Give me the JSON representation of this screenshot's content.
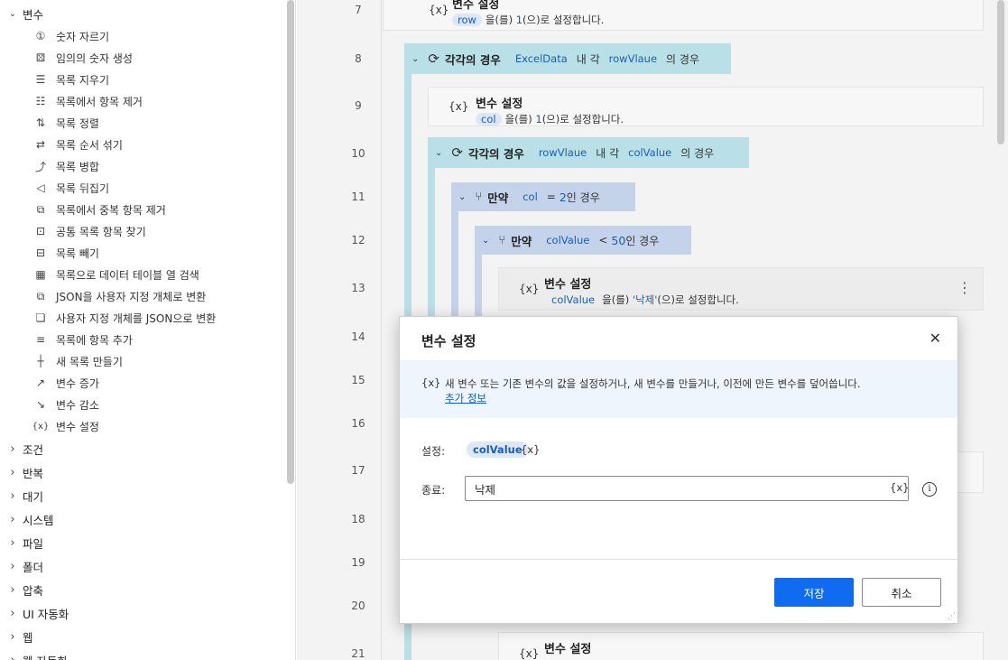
{
  "sidebar": {
    "open_category": "변수",
    "actions": [
      {
        "icon": "number-trim-icon",
        "label": "숫자 자르기"
      },
      {
        "icon": "random-number-icon",
        "label": "임의의 숫자 생성"
      },
      {
        "icon": "clear-list-icon",
        "label": "목록 지우기"
      },
      {
        "icon": "remove-item-icon",
        "label": "목록에서 항목 제거"
      },
      {
        "icon": "sort-list-icon",
        "label": "목록 정렬"
      },
      {
        "icon": "shuffle-list-icon",
        "label": "목록 순서 섞기"
      },
      {
        "icon": "merge-list-icon",
        "label": "목록 병합"
      },
      {
        "icon": "reverse-list-icon",
        "label": "목록 뒤집기"
      },
      {
        "icon": "remove-duplicates-icon",
        "label": "목록에서 중복 항목 제거"
      },
      {
        "icon": "common-items-icon",
        "label": "공통 목록 항목 찾기"
      },
      {
        "icon": "subtract-list-icon",
        "label": "목록 빼기"
      },
      {
        "icon": "list-to-datatable-icon",
        "label": "목록으로 데이터 테이블 열 검색"
      },
      {
        "icon": "json-to-object-icon",
        "label": "JSON을 사용자 지정 개체로 변환"
      },
      {
        "icon": "object-to-json-icon",
        "label": "사용자 지정 개체를 JSON으로 변환"
      },
      {
        "icon": "add-item-icon",
        "label": "목록에 항목 추가"
      },
      {
        "icon": "new-list-icon",
        "label": "새 목록 만들기"
      },
      {
        "icon": "increase-icon",
        "label": "변수 증가"
      },
      {
        "icon": "decrease-icon",
        "label": "변수 감소"
      },
      {
        "icon": "variable-icon",
        "label": "변수 설정"
      }
    ],
    "categories": [
      "조건",
      "반복",
      "대기",
      "시스템",
      "파일",
      "폴더",
      "압축",
      "UI 자동화",
      "웹",
      "웹 자동화"
    ]
  },
  "flow": {
    "line_numbers": [
      "7",
      "8",
      "9",
      "10",
      "11",
      "12",
      "13",
      "14",
      "15",
      "16",
      "17",
      "18",
      "19",
      "20",
      "21"
    ],
    "step7": {
      "title": "변수 설정",
      "var": "row",
      "mid": "을(를)",
      "value": "1",
      "suffix": "(으)로 설정합니다."
    },
    "loop8": {
      "keyword": "각각의 경우",
      "list": "ExcelData",
      "mid": "내 각",
      "item": "rowVlaue",
      "suffix": "의 경우"
    },
    "step9": {
      "title": "변수 설정",
      "var": "col",
      "mid": "을(를)",
      "value": "1",
      "suffix": "(으)로 설정합니다."
    },
    "loop10": {
      "keyword": "각각의 경우",
      "list": "rowVlaue",
      "mid": "내 각",
      "item": "colValue",
      "suffix": "의 경우"
    },
    "if11": {
      "keyword": "만약",
      "var": "col",
      "op": "=",
      "value": "2",
      "suffix": "인 경우"
    },
    "if12": {
      "keyword": "만약",
      "var": "colValue",
      "op": "<",
      "value": "50",
      "suffix": "인 경우"
    },
    "step13": {
      "title": "변수 설정",
      "var": "colValue",
      "mid": "을(를)",
      "value": "'낙제'",
      "suffix": "(으)로 설정합니다."
    },
    "step21": {
      "title": "변수 설정"
    }
  },
  "dialog": {
    "title": "변수 설정",
    "info_icon": "{x}",
    "info_text": "새 변수 또는 기존 변수의 값을 설정하거나, 새 변수를 만들거나, 이전에 만든 변수를 덮어씁니다.",
    "more_link": "추가 정보",
    "set_label": "설정:",
    "set_var": "colValue",
    "set_icon": "{x}",
    "value_label": "종료:",
    "value": "낙제",
    "value_icon": "{x}",
    "save_label": "저장",
    "cancel_label": "취소"
  },
  "colors": {
    "loop_band": "#b9e0e6",
    "if_band": "#c5d3ea",
    "primary": "#0f6cf0",
    "link": "#1a5fb4"
  }
}
